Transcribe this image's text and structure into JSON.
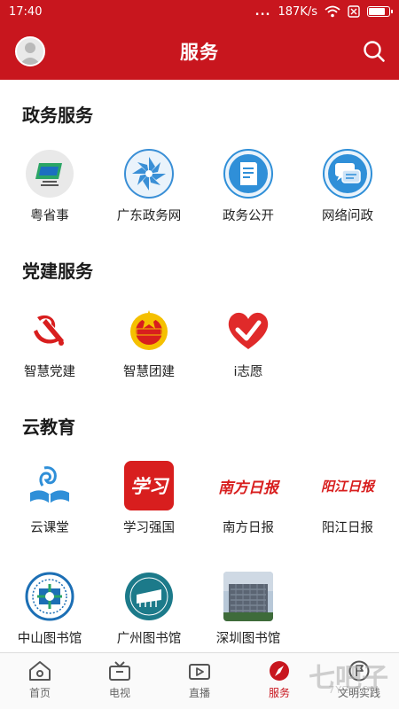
{
  "status_bar": {
    "time": "17:40",
    "dots": "...",
    "speed": "187K/s",
    "battery_level": 0.85
  },
  "header": {
    "title": "服务"
  },
  "sections": [
    {
      "title": "政务服务",
      "items": [
        {
          "label": "粤省事",
          "icon": "yue-shengshi-icon"
        },
        {
          "label": "广东政务网",
          "icon": "guangdong-gov-icon"
        },
        {
          "label": "政务公开",
          "icon": "document-icon"
        },
        {
          "label": "网络问政",
          "icon": "chat-bubbles-icon"
        }
      ]
    },
    {
      "title": "党建服务",
      "items": [
        {
          "label": "智慧党建",
          "icon": "party-emblem-icon"
        },
        {
          "label": "智慧团建",
          "icon": "youth-league-emblem-icon"
        },
        {
          "label": "i志愿",
          "icon": "heart-hand-icon"
        }
      ]
    },
    {
      "title": "云教育",
      "items": [
        {
          "label": "云课堂",
          "icon": "open-book-icon"
        },
        {
          "label": "学习强国",
          "icon": "xuexi-qiangguo-icon",
          "logo_text": "学习"
        },
        {
          "label": "南方日报",
          "icon": "nanfang-daily-logo",
          "logo_text": "南方日报"
        },
        {
          "label": "阳江日报",
          "icon": "yangjiang-daily-logo",
          "logo_text": "阳江日报"
        },
        {
          "label": "中山图书馆",
          "icon": "zhongshan-library-icon"
        },
        {
          "label": "广州图书馆",
          "icon": "guangzhou-library-icon"
        },
        {
          "label": "深圳图书馆",
          "icon": "shenzhen-library-photo"
        }
      ]
    }
  ],
  "tabs": [
    {
      "label": "首页",
      "icon": "home-icon",
      "active": false
    },
    {
      "label": "电视",
      "icon": "tv-icon",
      "active": false
    },
    {
      "label": "直播",
      "icon": "live-video-icon",
      "active": false
    },
    {
      "label": "服务",
      "icon": "compass-icon",
      "active": true
    },
    {
      "label": "文明实践",
      "icon": "flag-circle-icon",
      "active": false
    }
  ],
  "watermark": {
    "text": "七吧子",
    "sub": "7YZ.COM"
  },
  "colors": {
    "brand_red": "#c8161e",
    "blue": "#2f8fd8",
    "text": "#222222",
    "tab_inactive": "#666666"
  }
}
